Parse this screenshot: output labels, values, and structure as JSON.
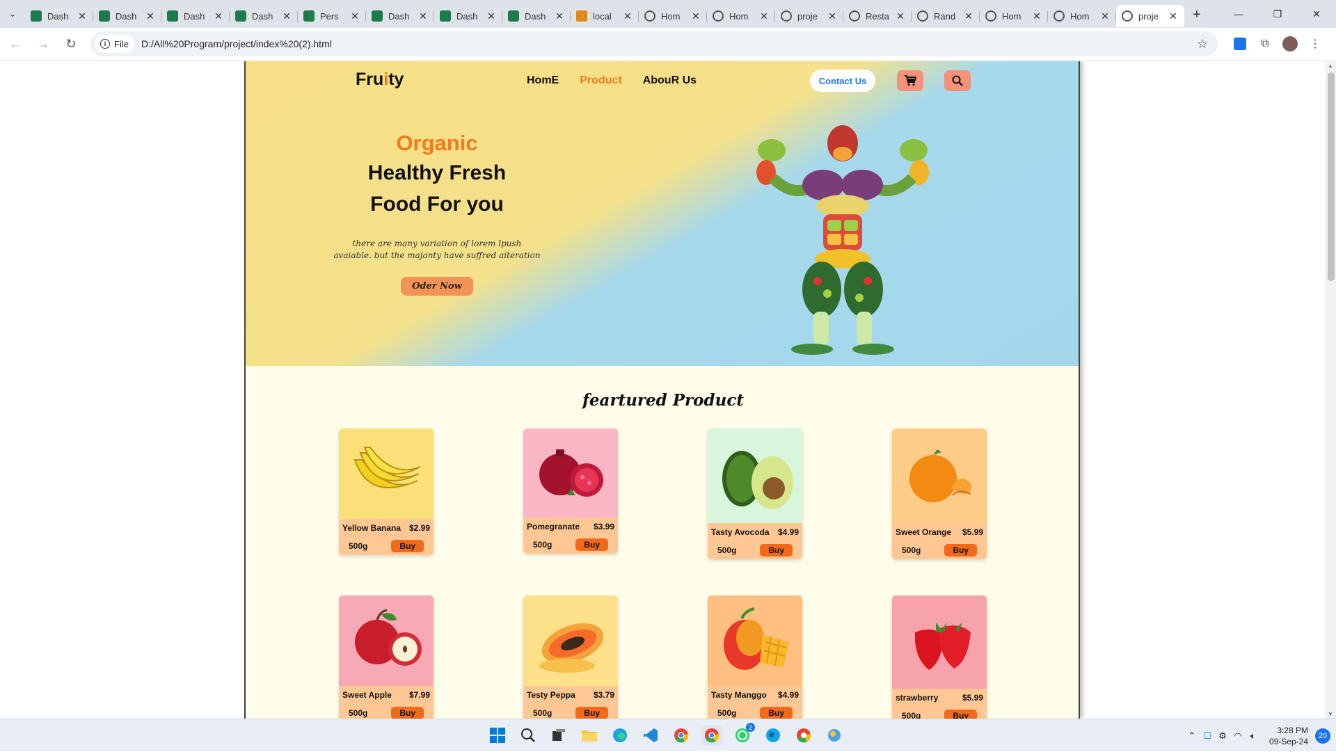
{
  "browser": {
    "tabs": [
      {
        "label": "Dash",
        "icon": "dashboard-favicon"
      },
      {
        "label": "Dash",
        "icon": "dashboard-favicon"
      },
      {
        "label": "Dash",
        "icon": "dashboard-favicon"
      },
      {
        "label": "Dash",
        "icon": "dashboard-favicon"
      },
      {
        "label": "Pers",
        "icon": "dashboard-favicon"
      },
      {
        "label": "Dash",
        "icon": "dashboard-favicon"
      },
      {
        "label": "Dash",
        "icon": "dashboard-favicon"
      },
      {
        "label": "Dash",
        "icon": "dashboard-favicon"
      },
      {
        "label": "local",
        "icon": "xampp-favicon"
      },
      {
        "label": "Hom",
        "icon": "globe-favicon"
      },
      {
        "label": "Hom",
        "icon": "globe-favicon"
      },
      {
        "label": "proje",
        "icon": "globe-favicon"
      },
      {
        "label": "Resta",
        "icon": "globe-favicon"
      },
      {
        "label": "Rand",
        "icon": "globe-favicon"
      },
      {
        "label": "Hom",
        "icon": "globe-favicon"
      },
      {
        "label": "Hom",
        "icon": "globe-favicon"
      },
      {
        "label": "proje",
        "icon": "globe-favicon",
        "active": true
      }
    ],
    "chip_label": "File",
    "url": "D:/All%20Program/project/index%20(2).html"
  },
  "site": {
    "logo_pre": "Fru",
    "logo_accent": "i",
    "logo_post": "ty",
    "nav": [
      "HomE",
      "Product",
      "AbouR Us"
    ],
    "contact_label": "Contact Us",
    "hero": {
      "kicker": "Organic",
      "headline_line1": "Healthy Fresh",
      "headline_line2": "Food For you",
      "sub_line1": "there are many variation of lorem lpush",
      "sub_line2": "avaiable. but the majanty have suffred aiteration",
      "cta": "Oder Now"
    },
    "section_title": "feartured Product",
    "products": [
      {
        "name": "Yellow Banana",
        "price": "$2.99",
        "weight": "500g",
        "buy": "Buy",
        "bg": "#fbe07a",
        "fruit": "banana"
      },
      {
        "name": "Pomegranate",
        "price": "$3.99",
        "weight": "500g",
        "buy": "Buy",
        "bg": "#f9b6c4",
        "fruit": "pomegranate"
      },
      {
        "name": "Tasty Avocoda",
        "price": "$4.99",
        "weight": "500g",
        "buy": "Buy",
        "bg": "#d8f6dc",
        "fruit": "avocado"
      },
      {
        "name": "Sweet Orange",
        "price": "$5.99",
        "weight": "500g",
        "buy": "Buy",
        "bg": "#ffcc88",
        "fruit": "orange"
      },
      {
        "name": "Sweet Apple",
        "price": "$7.99",
        "weight": "500g",
        "buy": "Buy",
        "bg": "#f7a9b5",
        "fruit": "apple"
      },
      {
        "name": "Testy Peppa",
        "price": "$3.79",
        "weight": "500g",
        "buy": "Buy",
        "bg": "#fde18a",
        "fruit": "papaya"
      },
      {
        "name": "Tasty Manggo",
        "price": "$4.99",
        "weight": "500g",
        "buy": "Buy",
        "bg": "#ffbf80",
        "fruit": "mango"
      },
      {
        "name": "strawberry",
        "price": "$5.99",
        "weight": "500g",
        "buy": "Buy",
        "bg": "#f7a3ab",
        "fruit": "strawberry"
      }
    ]
  },
  "taskbar": {
    "time": "3:28 PM",
    "date": "09-Sep-24",
    "notifications": "20",
    "whatsapp_badge": "2"
  },
  "colors": {
    "accent": "#f07c1c",
    "buy": "#f06a1a",
    "card": "#ffc794",
    "page_bg": "#fefde9"
  }
}
